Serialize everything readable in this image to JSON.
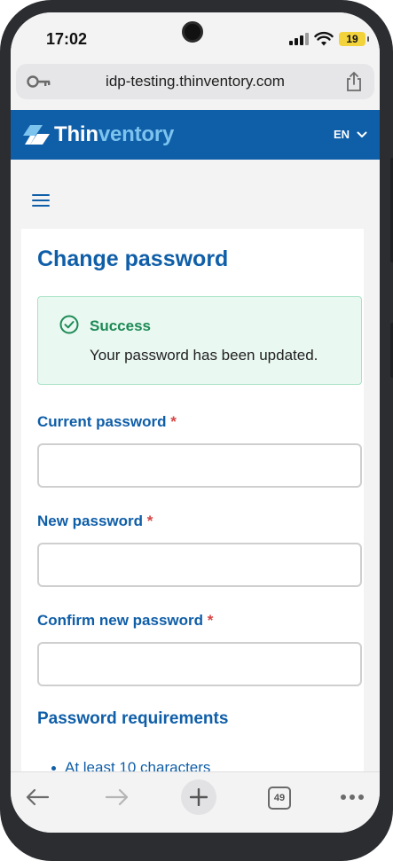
{
  "status_bar": {
    "time": "17:02",
    "battery": "19"
  },
  "browser": {
    "url": "idp-testing.thinventory.com"
  },
  "header": {
    "logo_part1": "Thin",
    "logo_part2": "ventory",
    "language": "EN"
  },
  "page": {
    "title": "Change password",
    "alert": {
      "title": "Success",
      "message": "Your password has been updated."
    },
    "fields": [
      {
        "label": "Current password",
        "required_mark": "*",
        "value": ""
      },
      {
        "label": "New password",
        "required_mark": "*",
        "value": ""
      },
      {
        "label": "Confirm new password",
        "required_mark": "*",
        "value": ""
      }
    ],
    "requirements_title": "Password requirements",
    "requirements": [
      "At least 10 characters"
    ]
  },
  "toolbar": {
    "tabs_count": "49"
  },
  "colors": {
    "brand_blue": "#0f5ea8",
    "brand_light_blue": "#7cc3ee",
    "success_green": "#1c8a55",
    "success_bg": "#e9f8f1",
    "required_red": "#d64545"
  }
}
